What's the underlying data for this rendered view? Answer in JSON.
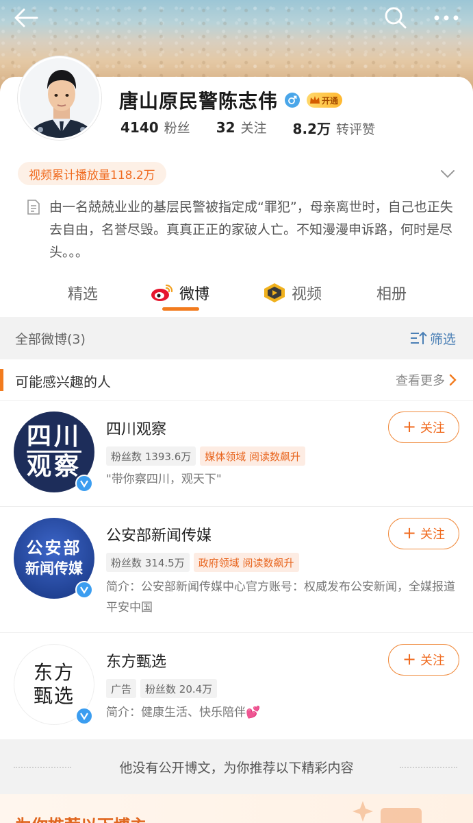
{
  "header": {
    "back": "back",
    "search": "search",
    "more": "more"
  },
  "profile": {
    "name": "唐山原民警陈志伟",
    "vip_label": "开通",
    "followers_count": "4140",
    "followers_label": "粉丝",
    "following_count": "32",
    "following_label": "关注",
    "likes_count": "8.2万",
    "likes_label": "转评赞",
    "video_plays": "视频累计播放量118.2万",
    "bio": "由一名兢兢业业的基层民警被指定成“罪犯”，母亲离世时，自己也正失去自由，名誉尽毁。真真正正的家破人亡。不知漫漫申诉路，何时是尽头。。。"
  },
  "tabs": [
    {
      "label": "精选"
    },
    {
      "label": "微博"
    },
    {
      "label": "视频"
    },
    {
      "label": "相册"
    }
  ],
  "filter": {
    "all_label": "全部微博(3)",
    "filter_label": "筛选"
  },
  "suggest": {
    "title": "可能感兴趣的人",
    "see_more": "查看更多",
    "people": [
      {
        "name": "四川观察",
        "avatar_text_1": "四川",
        "avatar_text_2": "观察",
        "tags": [
          "粉丝数 1393.6万",
          "媒体领域 阅读数飙升"
        ],
        "desc": "\"带你察四川，观天下\"",
        "follow_label": "关注"
      },
      {
        "name": "公安部新闻传媒",
        "avatar_text_1": "公安部",
        "avatar_text_2": "新闻传媒",
        "tags": [
          "粉丝数 314.5万",
          "政府领域 阅读数飙升"
        ],
        "desc": "简介：公安部新闻传媒中心官方账号：权威发布公安新闻，全媒报道平安中国",
        "follow_label": "关注"
      },
      {
        "name": "东方甄选",
        "avatar_text_1": "东方",
        "avatar_text_2": "甄选",
        "tags": [
          "广告",
          "粉丝数 20.4万"
        ],
        "desc": "简介：健康生活、快乐陪伴💕",
        "follow_label": "关注"
      }
    ]
  },
  "no_posts": "他没有公开博文，为你推荐以下精彩内容",
  "recommend_title": "为你推荐以下博主",
  "colors": {
    "accent": "#f27b1e",
    "link": "#4a7fb5",
    "verified": "#3b9df0"
  }
}
